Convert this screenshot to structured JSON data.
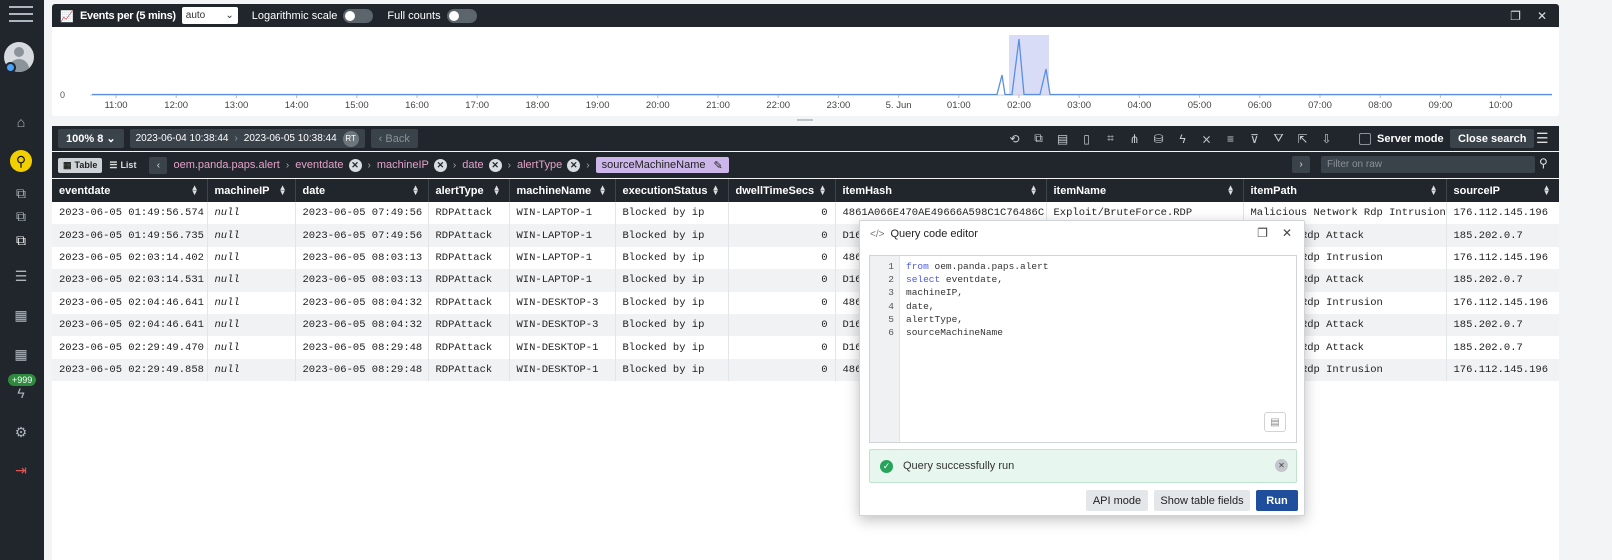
{
  "chart_panel": {
    "title": "Events per (5 mins)",
    "interval": "auto",
    "log_scale_label": "Logarithmic scale",
    "full_counts_label": "Full counts",
    "y_zero": "0",
    "x_ticks": [
      "11:00",
      "12:00",
      "13:00",
      "14:00",
      "15:00",
      "16:00",
      "17:00",
      "18:00",
      "19:00",
      "20:00",
      "21:00",
      "22:00",
      "23:00",
      "5. Jun",
      "01:00",
      "02:00",
      "03:00",
      "04:00",
      "05:00",
      "06:00",
      "07:00",
      "08:00",
      "09:00",
      "10:00"
    ]
  },
  "toolbar": {
    "zoom": "100% 8",
    "range_start": "2023-06-04 10:38:44",
    "range_end": "2023-06-05 10:38:44",
    "rt": "RT",
    "back": "Back",
    "server_mode": "Server mode",
    "close_search": "Close search"
  },
  "querybar": {
    "table_label": "Table",
    "list_label": "List",
    "source": "oem.panda.paps.alert",
    "crumbs": [
      "eventdate",
      "machineIP",
      "date",
      "alertType"
    ],
    "selected_crumb": "sourceMachineName",
    "raw_placeholder": "Filter on raw"
  },
  "table": {
    "columns": [
      "eventdate",
      "machineIP",
      "date",
      "alertType",
      "machineName",
      "executionStatus",
      "dwellTimeSecs",
      "itemHash",
      "itemName",
      "itemPath",
      "sourceIP"
    ],
    "rows": [
      [
        "2023-06-05 01:49:56.574",
        "null",
        "2023-06-05 07:49:56",
        "RDPAttack",
        "WIN-LAPTOP-1",
        "Blocked by ip",
        "0",
        "4861A066E470AE49666A598C1C76486C",
        "Exploit/BruteForce.RDP",
        "Malicious Network Rdp Intrusion",
        "176.112.145.196"
      ],
      [
        "2023-06-05 01:49:56.735",
        "null",
        "2023-06-05 07:49:56",
        "RDPAttack",
        "WIN-LAPTOP-1",
        "Blocked by ip",
        "0",
        "D16",
        "",
        "Network Rdp Attack",
        "185.202.0.7"
      ],
      [
        "2023-06-05 02:03:14.402",
        "null",
        "2023-06-05 08:03:13",
        "RDPAttack",
        "WIN-LAPTOP-1",
        "Blocked by ip",
        "0",
        "486",
        "",
        "Network Rdp Intrusion",
        "176.112.145.196"
      ],
      [
        "2023-06-05 02:03:14.531",
        "null",
        "2023-06-05 08:03:13",
        "RDPAttack",
        "WIN-LAPTOP-1",
        "Blocked by ip",
        "0",
        "D16",
        "",
        "Network Rdp Attack",
        "185.202.0.7"
      ],
      [
        "2023-06-05 02:04:46.641",
        "null",
        "2023-06-05 08:04:32",
        "RDPAttack",
        "WIN-DESKTOP-3",
        "Blocked by ip",
        "0",
        "486",
        "",
        "Network Rdp Intrusion",
        "176.112.145.196"
      ],
      [
        "2023-06-05 02:04:46.641",
        "null",
        "2023-06-05 08:04:32",
        "RDPAttack",
        "WIN-DESKTOP-3",
        "Blocked by ip",
        "0",
        "D16",
        "",
        "Network Rdp Attack",
        "185.202.0.7"
      ],
      [
        "2023-06-05 02:29:49.470",
        "null",
        "2023-06-05 08:29:48",
        "RDPAttack",
        "WIN-DESKTOP-1",
        "Blocked by ip",
        "0",
        "D16",
        "",
        "Network Rdp Attack",
        "185.202.0.7"
      ],
      [
        "2023-06-05 02:29:49.858",
        "null",
        "2023-06-05 08:29:48",
        "RDPAttack",
        "WIN-DESKTOP-1",
        "Blocked by ip",
        "0",
        "486",
        "",
        "Network Rdp Intrusion",
        "176.112.145.196"
      ]
    ]
  },
  "dialog": {
    "title": "Query code editor",
    "code_lines": [
      {
        "kw": "from",
        "rest": " oem.panda.paps.alert"
      },
      {
        "kw": "select",
        "rest": " eventdate,"
      },
      {
        "kw": "",
        "rest": "machineIP,"
      },
      {
        "kw": "",
        "rest": "date,"
      },
      {
        "kw": "",
        "rest": "alertType,"
      },
      {
        "kw": "",
        "rest": "sourceMachineName"
      }
    ],
    "success": "Query successfully run",
    "api_mode": "API mode",
    "show_fields": "Show table fields",
    "run": "Run"
  },
  "sidebar": {
    "badge": "+999"
  }
}
